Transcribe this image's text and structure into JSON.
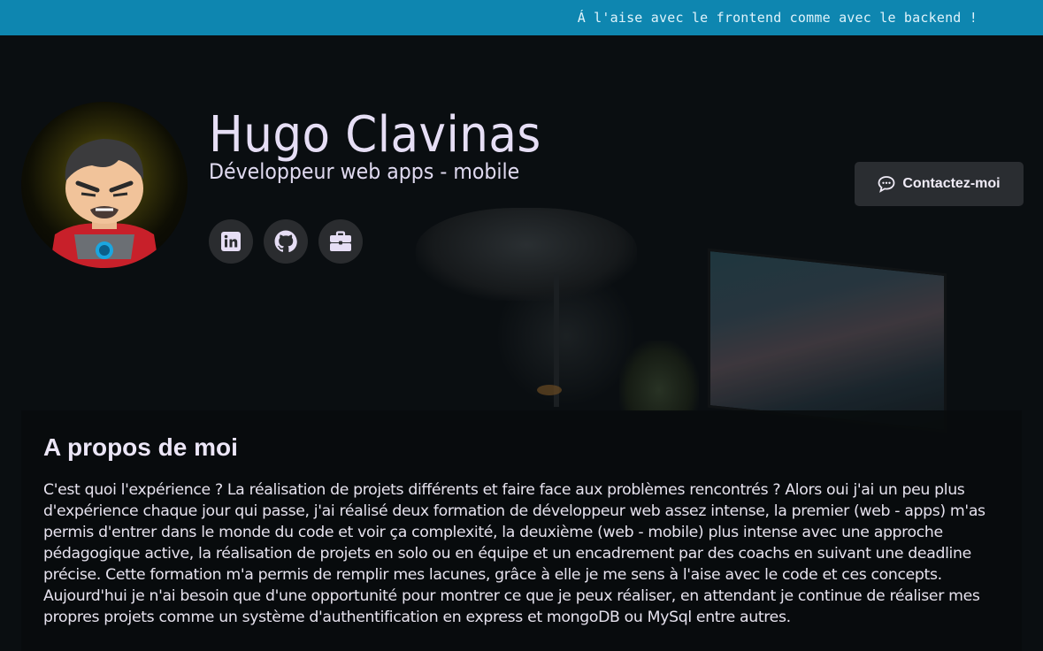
{
  "banner": {
    "text": "Á l'aise avec le frontend comme avec le backend !"
  },
  "profile": {
    "name": "Hugo Clavinas",
    "title": "Développeur web apps - mobile"
  },
  "social": [
    {
      "icon": "linkedin-icon"
    },
    {
      "icon": "github-icon"
    },
    {
      "icon": "briefcase-icon"
    }
  ],
  "contact": {
    "label": "Contactez-moi",
    "icon": "chat-icon"
  },
  "about": {
    "heading": "A propos de moi",
    "body": "C'est quoi l'expérience ? La réalisation de projets différents et faire face aux problèmes rencontrés ? Alors oui j'ai un peu plus d'expérience chaque jour qui passe, j'ai réalisé deux formation de développeur web assez intense, la premier (web - apps) m'as permis d'entrer dans le monde du code et voir ça complexité, la deuxième (web - mobile) plus intense avec une approche pédagogique active, la réalisation de projets en solo ou en équipe et un encadrement par des coachs en suivant une deadline précise. Cette formation m'a permis de remplir mes lacunes, grâce à elle je me sens à l'aise avec le code et ces concepts. Aujourd'hui je n'ai besoin que d'une opportunité pour montrer ce que je peux réaliser, en attendant je continue de réaliser mes propres projets comme un système d'authentification en express et mongoDB ou MySql entre autres."
  },
  "colors": {
    "banner": "#0e86b0",
    "accent_text": "#e6def5",
    "button_bg": "#2a2d31"
  }
}
